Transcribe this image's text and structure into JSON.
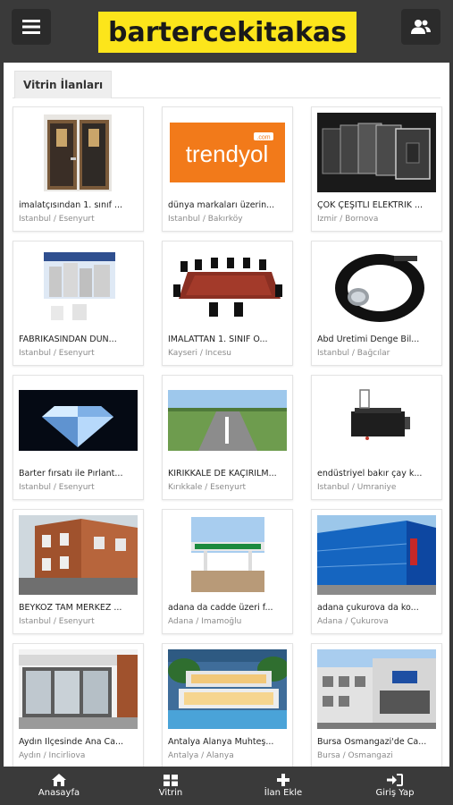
{
  "header": {
    "logo_text": "bartercekitakas",
    "menu_icon": "hamburger-icon",
    "user_icon": "users-icon"
  },
  "tabs": [
    {
      "label": "Vitrin İlanları"
    }
  ],
  "listings": [
    {
      "title": "imalatçısından 1. sınıf ...",
      "location": "İstanbul / Esenyurt"
    },
    {
      "title": "dünya markaları üzerin...",
      "location": "İstanbul / Bakırköy"
    },
    {
      "title": "ÇOK ÇEŞİTLİ ELEKTRİK ...",
      "location": "İzmir / Bornova"
    },
    {
      "title": "FABRİKASINDAN DÜN...",
      "location": "İstanbul / Esenyurt"
    },
    {
      "title": "İMALATTAN 1. SINIF O...",
      "location": "Kayseri / İncesu"
    },
    {
      "title": "Abd Üretimi Denge Bil...",
      "location": "İstanbul / Bağcılar"
    },
    {
      "title": "Barter fırsatı ile Pırlant...",
      "location": "İstanbul / Esenyurt"
    },
    {
      "title": "KIRIKKALE DE KAÇIRILM...",
      "location": "Kırıkkale / Esenyurt"
    },
    {
      "title": "endüstriyel bakır çay k...",
      "location": "İstanbul / Ümraniye"
    },
    {
      "title": "BEYKOZ TAM MERKEZ ...",
      "location": "İstanbul / Esenyurt"
    },
    {
      "title": "adana da cadde üzeri f...",
      "location": "Adana / İmamoğlu"
    },
    {
      "title": "adana çukurova da ko...",
      "location": "Adana / Çukurova"
    },
    {
      "title": "Aydın İlçesinde Ana Ca...",
      "location": "Aydın / İncirliova"
    },
    {
      "title": "Antalya Alanya Muhteş...",
      "location": "Antalya / Alanya"
    },
    {
      "title": "Bursa Osmangazi'de Ca...",
      "location": "Bursa / Osmangazi"
    }
  ],
  "trendyol_logo": {
    "text": "trendyol",
    "badge": ".com"
  },
  "bottom_nav": [
    {
      "label": "Anasayfa",
      "icon": "home-icon"
    },
    {
      "label": "Vitrin",
      "icon": "grid-icon"
    },
    {
      "label": "İlan Ekle",
      "icon": "plus-icon"
    },
    {
      "label": "Giriş Yap",
      "icon": "sign-in-icon"
    }
  ],
  "colors": {
    "accent": "#fce51b",
    "bar": "#3a3a3a",
    "trendyol": "#f27a1a"
  }
}
